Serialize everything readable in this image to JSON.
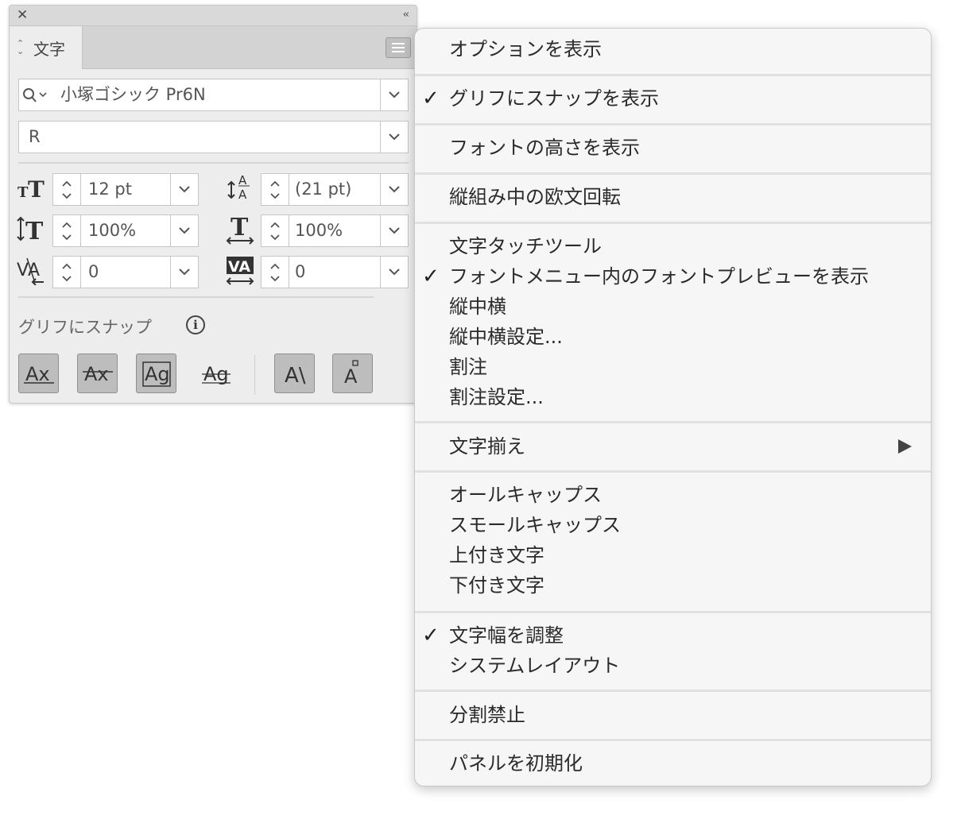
{
  "panel": {
    "tab_label": "文字",
    "font_family": "小塚ゴシック Pr6N",
    "font_style": "R",
    "font_size": "12 pt",
    "leading": "(21 pt)",
    "vertical_scale": "100%",
    "horizontal_scale": "100%",
    "kerning": "0",
    "tracking": "0",
    "snap_label": "グリフにスナップ",
    "info_glyph": "i",
    "snap_buttons": [
      "Ax",
      "Ax",
      "Ag",
      "Ag",
      "A\\",
      "A"
    ]
  },
  "menu": {
    "items": [
      {
        "label": "オプションを表示",
        "checked": false
      },
      {
        "label": "グリフにスナップを表示",
        "checked": true
      },
      {
        "label": "フォントの高さを表示",
        "checked": false
      },
      {
        "label": "縦組み中の欧文回転",
        "checked": false
      },
      {
        "label": "文字タッチツール",
        "checked": false
      },
      {
        "label": "フォントメニュー内のフォントプレビューを表示",
        "checked": true
      },
      {
        "label": "縦中横",
        "checked": false
      },
      {
        "label": "縦中横設定...",
        "checked": false
      },
      {
        "label": "割注",
        "checked": false
      },
      {
        "label": "割注設定...",
        "checked": false
      },
      {
        "label": "文字揃え",
        "checked": false,
        "submenu": true
      },
      {
        "label": "オールキャップス",
        "checked": false
      },
      {
        "label": "スモールキャップス",
        "checked": false
      },
      {
        "label": "上付き文字",
        "checked": false
      },
      {
        "label": "下付き文字",
        "checked": false
      },
      {
        "label": "文字幅を調整",
        "checked": true
      },
      {
        "label": "システムレイアウト",
        "checked": false
      },
      {
        "label": "分割禁止",
        "checked": false
      },
      {
        "label": "パネルを初期化",
        "checked": false
      }
    ],
    "check_glyph": "✓"
  }
}
